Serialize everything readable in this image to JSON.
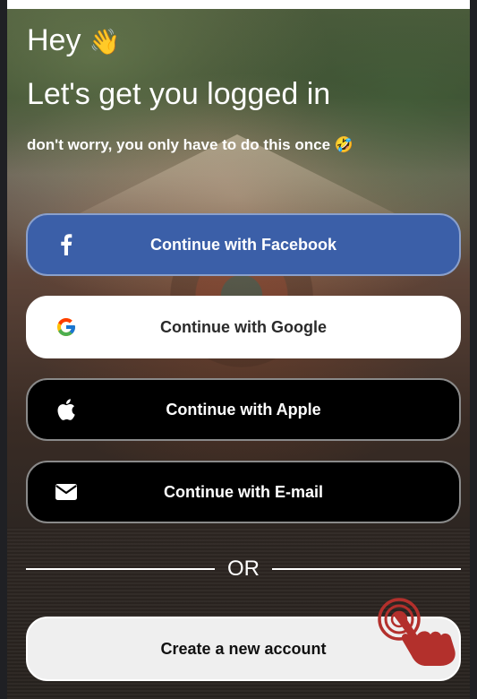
{
  "header": {
    "greeting": "Hey",
    "greeting_emoji": "👋",
    "headline": "Let's get you logged in",
    "subtitle": "don't worry, you only have to do this once",
    "subtitle_emoji": "🤣"
  },
  "buttons": {
    "facebook_label": "Continue with Facebook",
    "google_label": "Continue with Google",
    "apple_label": "Continue with Apple",
    "email_label": "Continue with E-mail",
    "create_label": "Create a new account"
  },
  "divider": {
    "label": "OR"
  },
  "icons": {
    "facebook": "facebook-icon",
    "google": "google-icon",
    "apple": "apple-icon",
    "email": "envelope-icon",
    "tap_hint": "tap-hand-icon"
  },
  "colors": {
    "facebook_blue": "#3b5fa8",
    "tap_hint_red": "#b3302c"
  }
}
